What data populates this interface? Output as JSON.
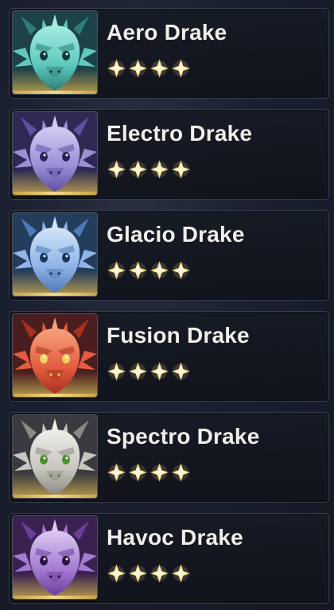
{
  "drakes": [
    {
      "name": "Aero Drake",
      "rarity": 4,
      "colors": {
        "bgTop": "#1d4248",
        "bgBot": "#b59b4e",
        "main": "#5fc9bd",
        "light": "#a7ece1",
        "dark": "#2c7f79",
        "eye": "#0b3b3b"
      }
    },
    {
      "name": "Electro Drake",
      "rarity": 4,
      "colors": {
        "bgTop": "#2d2b54",
        "bgBot": "#b59b4e",
        "main": "#9c8fd6",
        "light": "#d4cdf4",
        "dark": "#5f50a6",
        "eye": "#2a1f5e"
      }
    },
    {
      "name": "Glacio Drake",
      "rarity": 4,
      "colors": {
        "bgTop": "#253d5c",
        "bgBot": "#b59b4e",
        "main": "#8fb4e6",
        "light": "#d3e4fa",
        "dark": "#4d7ab8",
        "eye": "#16365e"
      }
    },
    {
      "name": "Fusion Drake",
      "rarity": 4,
      "colors": {
        "bgTop": "#4a1e1e",
        "bgBot": "#b59b4e",
        "main": "#e35c40",
        "light": "#f6a27c",
        "dark": "#a8311f",
        "eye": "#f1d25a"
      }
    },
    {
      "name": "Spectro Drake",
      "rarity": 4,
      "colors": {
        "bgTop": "#3a3a40",
        "bgBot": "#b59b4e",
        "main": "#c9c6c0",
        "light": "#efede8",
        "dark": "#8d8a84",
        "eye": "#4d8f2f"
      }
    },
    {
      "name": "Havoc Drake",
      "rarity": 4,
      "colors": {
        "bgTop": "#3a2250",
        "bgBot": "#b59b4e",
        "main": "#a47ad2",
        "light": "#dccaf2",
        "dark": "#6a3f9c",
        "eye": "#2a0f45"
      }
    }
  ],
  "accent": {
    "gold": "#f3d27a",
    "star": "#ffe7a6"
  }
}
